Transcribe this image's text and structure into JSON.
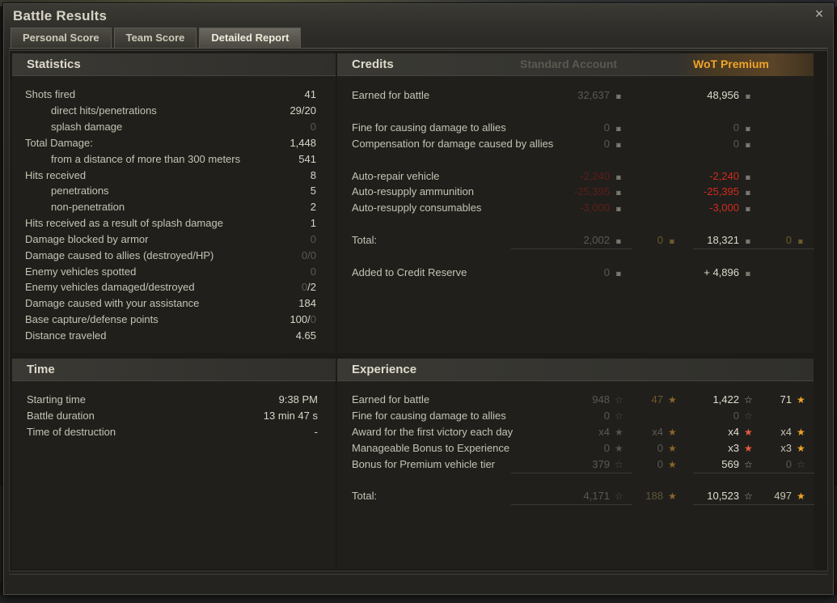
{
  "window": {
    "title": "Battle Results",
    "close_icon": "×"
  },
  "tabs": [
    {
      "label": "Personal Score",
      "active": false
    },
    {
      "label": "Team Score",
      "active": false
    },
    {
      "label": "Detailed Report",
      "active": true
    }
  ],
  "statistics": {
    "title": "Statistics",
    "rows": [
      {
        "label": "Shots fired",
        "value": "41"
      },
      {
        "label": "direct hits/penetrations",
        "value": "29/20"
      },
      {
        "label": "splash damage",
        "value": "0"
      },
      {
        "label": "Total Damage:",
        "value": "1,448"
      },
      {
        "label": "from a distance of more than 300 meters",
        "value": "541"
      },
      {
        "label": "Hits received",
        "value": "8"
      },
      {
        "label": "penetrations",
        "value": "5"
      },
      {
        "label": "non-penetration",
        "value": "2"
      },
      {
        "label": "Hits received as a result of splash damage",
        "value": "1"
      },
      {
        "label": "Damage blocked by armor",
        "value": "0"
      },
      {
        "label": "Damage caused to allies (destroyed/HP)",
        "value": "0/0"
      },
      {
        "label": "Enemy vehicles spotted",
        "value": "0"
      },
      {
        "label": "Enemy vehicles damaged/destroyed",
        "value_a": "0",
        "value_b": "/2"
      },
      {
        "label": "Damage caused with your assistance",
        "value": "184"
      },
      {
        "label": "Base capture/defense points",
        "value_a": "100/",
        "value_b": "0"
      },
      {
        "label": "Distance traveled",
        "value": "4.65"
      }
    ]
  },
  "time": {
    "title": "Time",
    "rows": [
      {
        "label": "Starting time",
        "value": "9:38 PM"
      },
      {
        "label": "Battle duration",
        "value": "13 min 47 s"
      },
      {
        "label": "Time of destruction",
        "value": "-"
      }
    ]
  },
  "credits": {
    "title": "Credits",
    "standard_label": "Standard Account",
    "premium_label": "WoT Premium",
    "rows": [
      {
        "label": "Earned for battle",
        "std": "32,637",
        "prem": "48,956"
      },
      {
        "label": "Fine for causing damage to allies",
        "std": "0",
        "prem": "0"
      },
      {
        "label": "Compensation for damage caused by allies",
        "std": "0",
        "prem": "0"
      },
      {
        "label": "Auto-repair vehicle",
        "std": "-2,240",
        "prem": "-2,240"
      },
      {
        "label": "Auto-resupply ammunition",
        "std": "-25,395",
        "prem": "-25,395"
      },
      {
        "label": "Auto-resupply consumables",
        "std": "-3,000",
        "prem": "-3,000"
      },
      {
        "label": "Total:",
        "std": "2,002",
        "std_gold": "0",
        "prem": "18,321",
        "prem_gold": "0"
      },
      {
        "label": "Added to Credit Reserve",
        "std": "0",
        "prem": "+ 4,896"
      }
    ]
  },
  "experience": {
    "title": "Experience",
    "rows": [
      {
        "label": "Earned for battle",
        "std_xp": "948",
        "std_free": "47",
        "prem_xp": "1,422",
        "prem_free": "71"
      },
      {
        "label": "Fine for causing damage to allies",
        "std_xp": "0",
        "prem_xp": "0"
      },
      {
        "label": "Award for the first victory each day",
        "std_xp": "x4",
        "std_free": "x4",
        "prem_xp": "x4",
        "prem_free": "x4"
      },
      {
        "label": "Manageable Bonus to Experience",
        "std_xp": "0",
        "std_free": "0",
        "prem_xp": "x3",
        "prem_free": "x3"
      },
      {
        "label": "Bonus for Premium vehicle tier",
        "std_xp": "379",
        "std_free": "0",
        "prem_xp": "569",
        "prem_free": "0"
      },
      {
        "label": "Total:",
        "std_xp": "4,171",
        "std_free": "188",
        "prem_xp": "10,523",
        "prem_free": "497"
      }
    ]
  },
  "icons": {
    "credit": "credit-coin-icon",
    "gold": "gold-coin-icon",
    "xp": "xp-star-icon",
    "free_xp": "free-xp-star-icon"
  },
  "colors": {
    "negative": "#d22b1c",
    "premium_accent": "#f0a428",
    "dim_text": "#5b5951"
  }
}
